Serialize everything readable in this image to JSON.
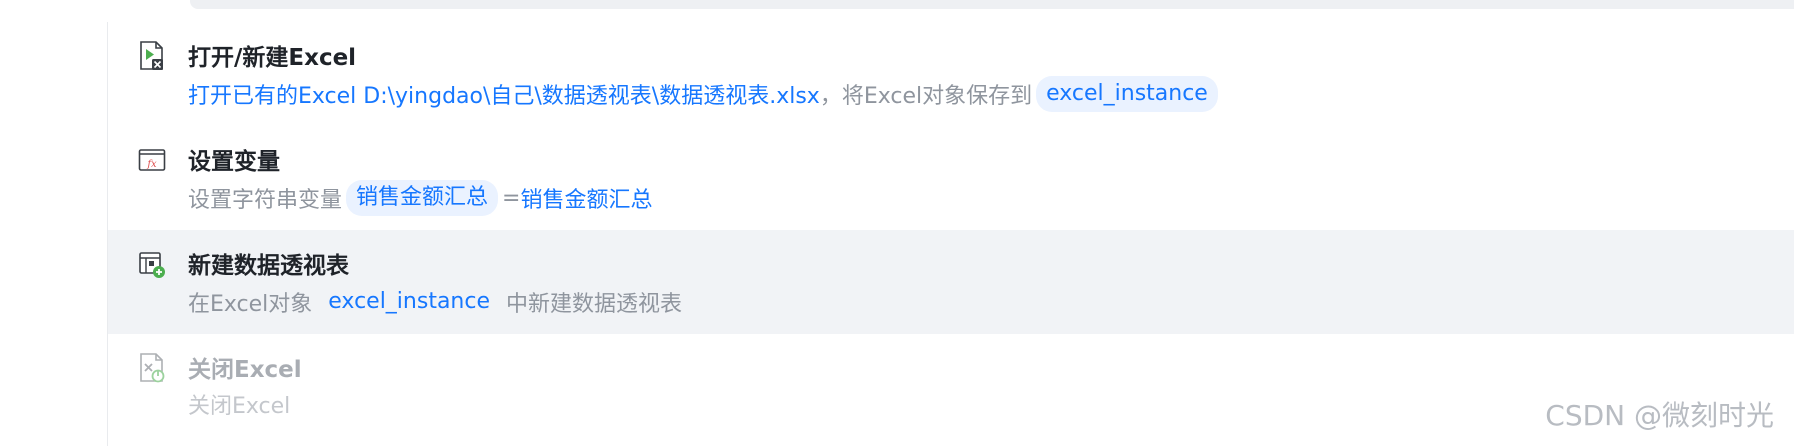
{
  "steps": [
    {
      "title": "打开/新建Excel",
      "icon": "excel-open-icon",
      "desc": {
        "part1": "打开已有的Excel D:\\yingdao\\自己\\数据透视表\\数据透视表.xlsx",
        "part2": "，将Excel对象保存到",
        "chip": "excel_instance"
      }
    },
    {
      "title": "设置变量",
      "icon": "function-fx-icon",
      "desc": {
        "part1": "设置字符串变量",
        "chip": "销售金额汇总",
        "eq": "=",
        "value": "销售金额汇总"
      }
    },
    {
      "title": "新建数据透视表",
      "icon": "pivot-table-add-icon",
      "desc": {
        "part1": "在Excel对象",
        "chip": "excel_instance",
        "part2": "中新建数据透视表"
      }
    },
    {
      "title": "关闭Excel",
      "icon": "excel-close-icon",
      "desc": {
        "part1": "关闭Excel"
      }
    }
  ],
  "watermark": "CSDN @微刻时光",
  "colors": {
    "accent": "#1677ff",
    "chip_bg": "#eaf2ff",
    "selected_row_bg": "#f1f3f6",
    "title": "#1f2329",
    "muted": "#8f959e"
  }
}
